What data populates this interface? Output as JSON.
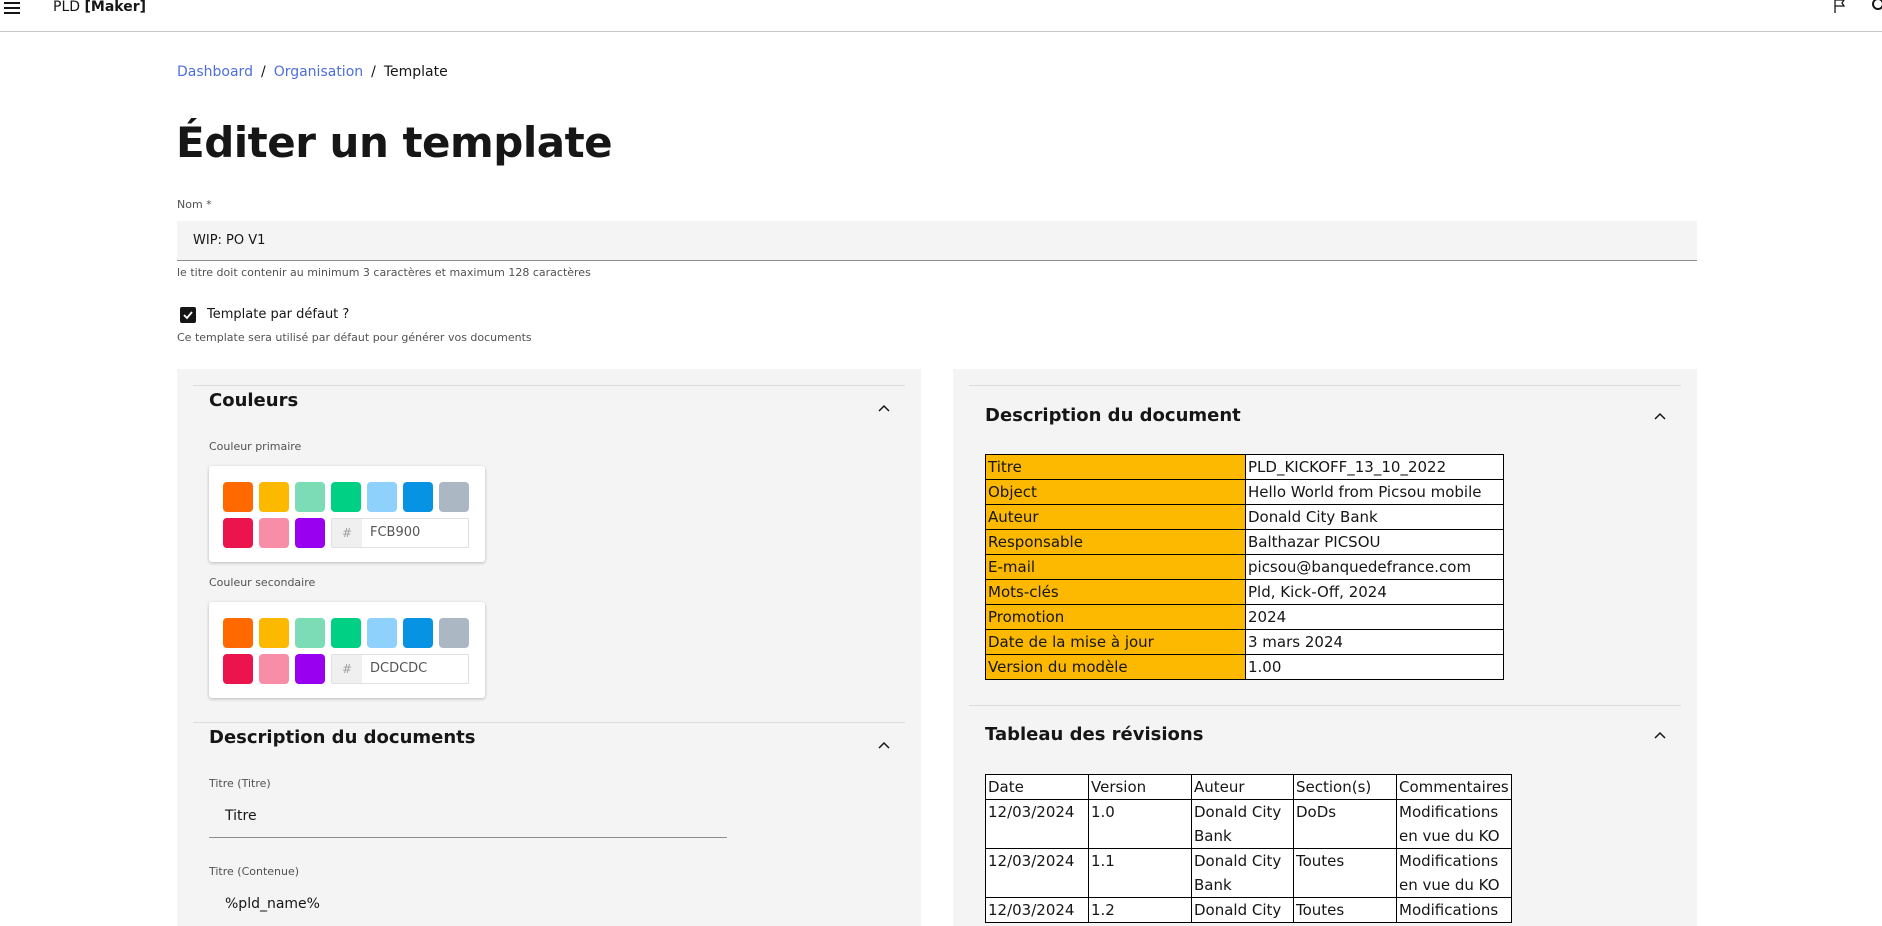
{
  "topbar": {
    "brand_prefix": "PLD ",
    "brand_bold": "[Maker]"
  },
  "breadcrumb": {
    "items": [
      "Dashboard",
      "Organisation"
    ],
    "current": "Template",
    "separator": "/"
  },
  "page": {
    "title": "Éditer un template"
  },
  "form": {
    "name_label": "Nom *",
    "name_value": "WIP: PO V1",
    "name_helper": "le titre doit contenir au minimum 3 caractères et maximum 128 caractères",
    "default_label": "Template par défaut ?",
    "default_checked": true,
    "default_helper": "Ce template sera utilisé par défaut pour générer vos documents"
  },
  "colors_section": {
    "title": "Couleurs",
    "primary_label": "Couleur primaire",
    "primary_hex": "FCB900",
    "secondary_label": "Couleur secondaire",
    "secondary_hex": "DCDCDC",
    "hash": "#",
    "swatches": [
      "#ff6900",
      "#fcb900",
      "#7bdcb5",
      "#00d084",
      "#8ed1fc",
      "#0693e3",
      "#abb8c3",
      "#eb144c",
      "#f78da7",
      "#9900ef"
    ]
  },
  "doc_form_section": {
    "title": "Description du documents",
    "field1_label": "Titre (Titre)",
    "field1_value": "Titre",
    "field2_label": "Titre (Contenue)",
    "field2_value": "%pld_name%"
  },
  "preview_description": {
    "title": "Description du document",
    "rows": [
      [
        "Titre",
        "PLD_KICKOFF_13_10_2022"
      ],
      [
        "Object",
        "Hello World from Picsou mobile"
      ],
      [
        "Auteur",
        "Donald City Bank"
      ],
      [
        "Responsable",
        "Balthazar PICSOU"
      ],
      [
        "E-mail",
        "picsou@banquedefrance.com"
      ],
      [
        "Mots-clés",
        "Pld, Kick-Off, 2024"
      ],
      [
        "Promotion",
        "2024"
      ],
      [
        "Date de la mise à jour",
        "3 mars 2024"
      ],
      [
        "Version du modèle",
        "1.00"
      ]
    ]
  },
  "preview_revisions": {
    "title": "Tableau des révisions",
    "headers": [
      "Date",
      "Version",
      "Auteur",
      "Section(s)",
      "Commentaires"
    ],
    "rows": [
      [
        "12/03/2024",
        "1.0",
        "Donald City Bank",
        "DoDs",
        "Modifications en vue du KO"
      ],
      [
        "12/03/2024",
        "1.1",
        "Donald City Bank",
        "Toutes",
        "Modifications en vue du KO"
      ],
      [
        "12/03/2024",
        "1.2",
        "Donald City",
        "Toutes",
        "Modifications"
      ]
    ]
  }
}
